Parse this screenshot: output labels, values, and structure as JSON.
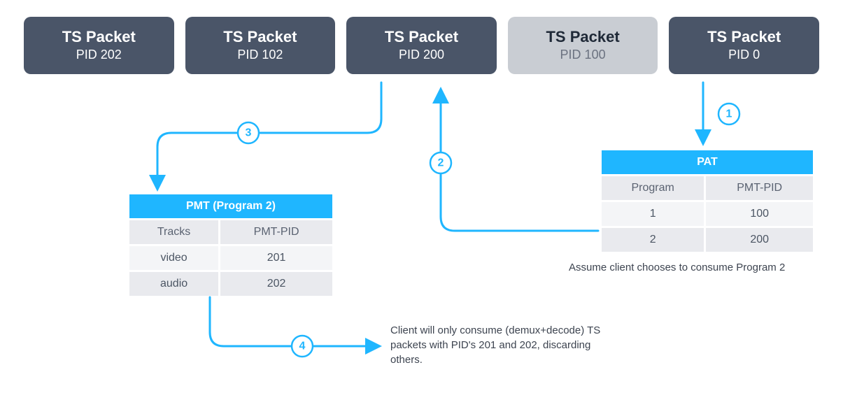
{
  "packets": [
    {
      "title": "TS Packet",
      "pid": "PID 202",
      "variant": "dark"
    },
    {
      "title": "TS Packet",
      "pid": "PID 102",
      "variant": "dark"
    },
    {
      "title": "TS Packet",
      "pid": "PID 200",
      "variant": "dark"
    },
    {
      "title": "TS Packet",
      "pid": "PID 100",
      "variant": "light"
    },
    {
      "title": "TS Packet",
      "pid": "PID 0",
      "variant": "dark"
    }
  ],
  "pat": {
    "title": "PAT",
    "cols": [
      "Program",
      "PMT-PID"
    ],
    "rows": [
      [
        "1",
        "100"
      ],
      [
        "2",
        "200"
      ]
    ]
  },
  "pmt": {
    "title": "PMT (Program 2)",
    "cols": [
      "Tracks",
      "PMT-PID"
    ],
    "rows": [
      [
        "video",
        "201"
      ],
      [
        "audio",
        "202"
      ]
    ]
  },
  "steps": {
    "s1": "1",
    "s2": "2",
    "s3": "3",
    "s4": "4"
  },
  "captions": {
    "pat_note": "Assume client chooses to consume Program 2",
    "final_note": "Client will only consume (demux+decode) TS packets with PID's 201 and 202, discarding others."
  }
}
